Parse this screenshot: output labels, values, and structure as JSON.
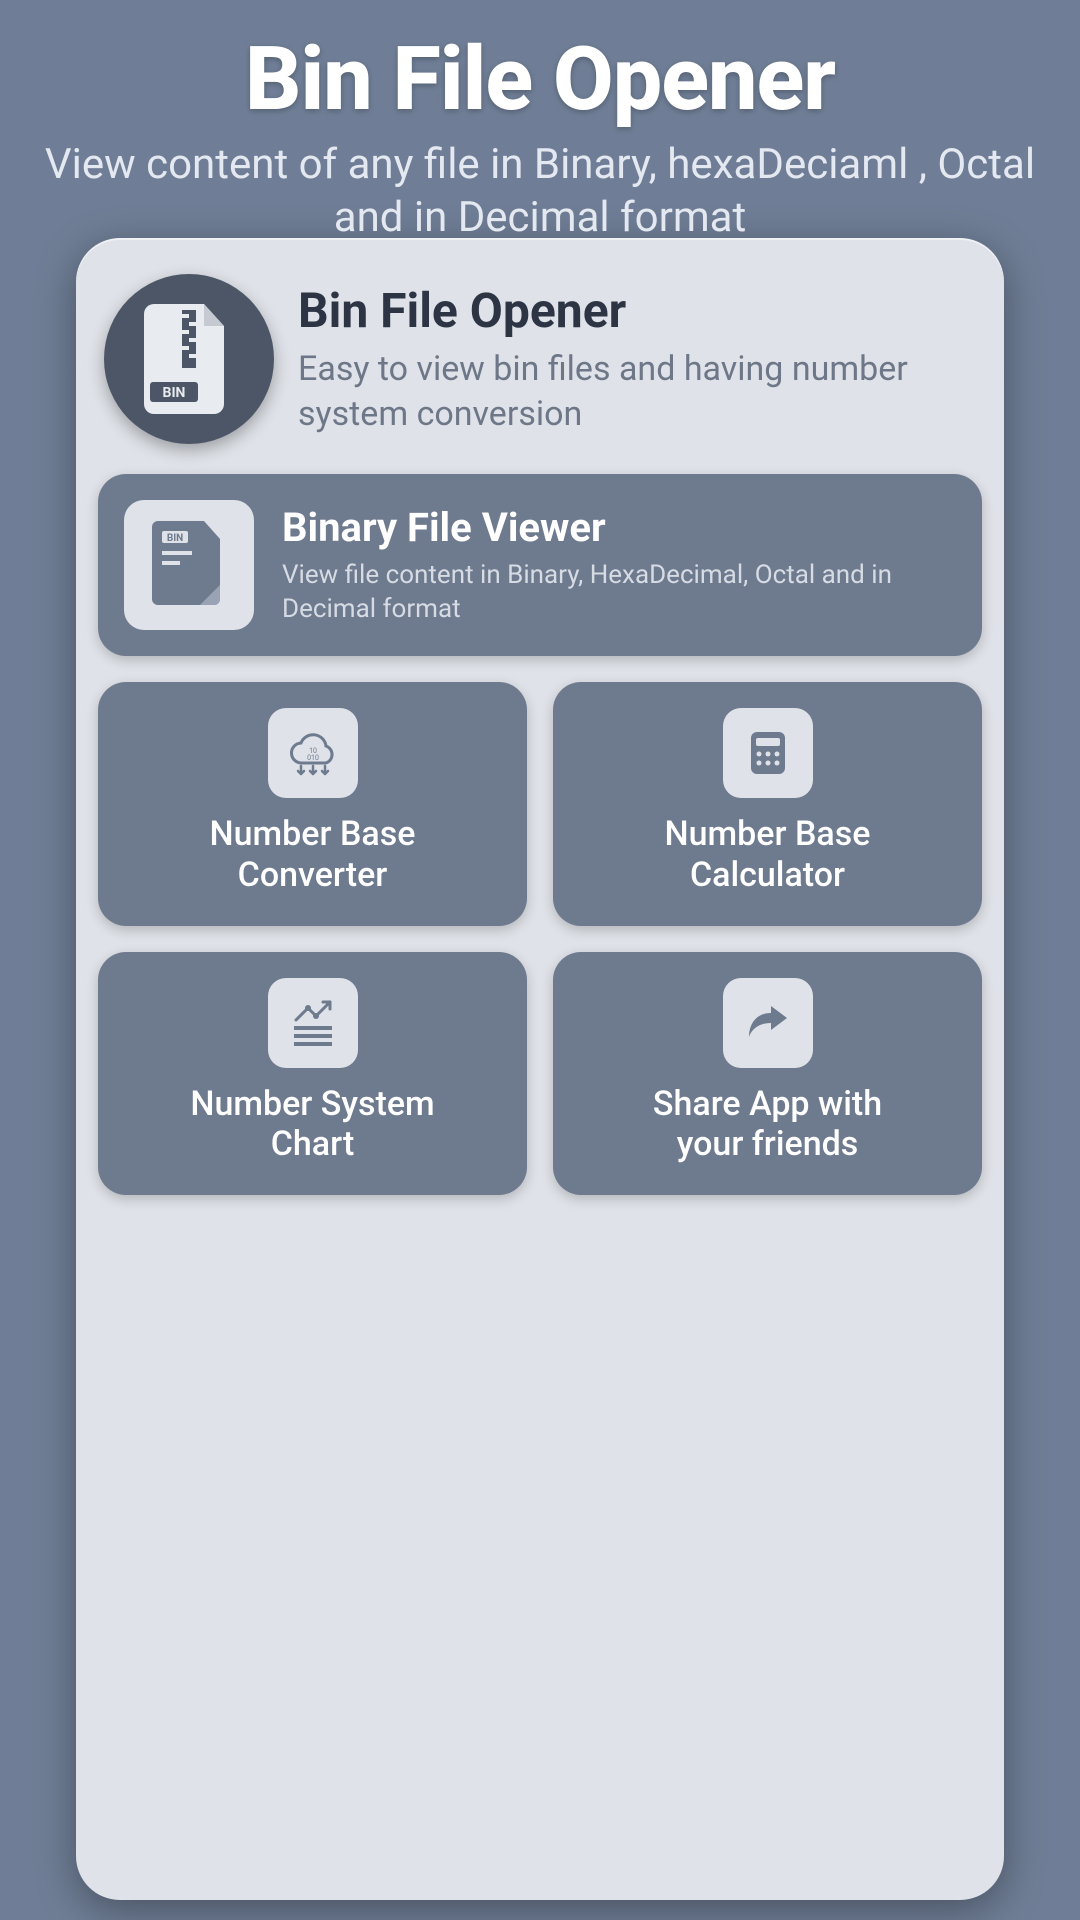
{
  "hero": {
    "title": "Bin File Opener",
    "subtitle": "View content of any file in Binary, hexaDeciaml , Octal and in Decimal format"
  },
  "app": {
    "name": "Bin File Opener",
    "tagline": "Easy to view bin files and having number system conversion",
    "icon_badge": "BIN"
  },
  "feature": {
    "title": "Binary File Viewer",
    "subtitle": "View file content in Binary, HexaDecimal, Octal and in Decimal format",
    "badge": "BIN"
  },
  "tiles": [
    {
      "label": "Number Base\nConverter",
      "icon": "cloud-binary-icon"
    },
    {
      "label": "Number Base\nCalculator",
      "icon": "calculator-icon"
    },
    {
      "label": "Number System\nChart",
      "icon": "chart-icon"
    },
    {
      "label": "Share App with\nyour friends",
      "icon": "share-icon"
    }
  ],
  "colors": {
    "bg": "#6f7e96",
    "card": "#dfe2e8",
    "tile": "#6e7a8e",
    "dark": "#4c5666"
  }
}
